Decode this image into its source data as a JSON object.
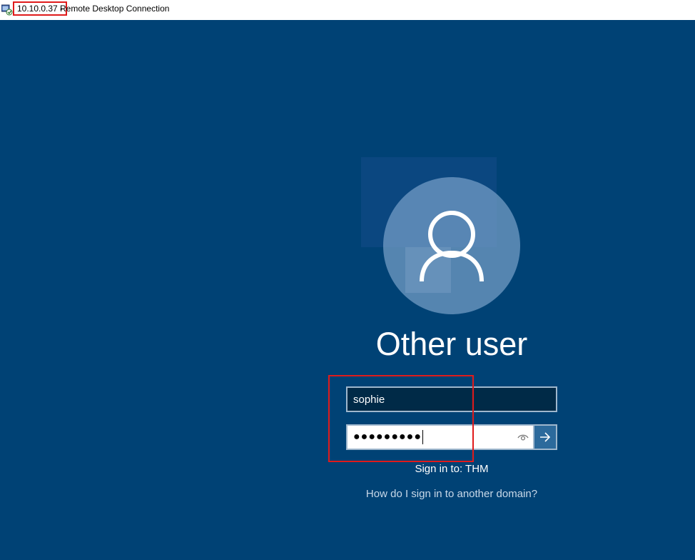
{
  "titlebar": {
    "ip": "10.10.0.37 -",
    "app_name": "Remote Desktop Connection",
    "icon": "remote-desktop-icon"
  },
  "login": {
    "user_display": "Other user",
    "avatar_icon": "user-silhouette-icon",
    "username_value": "sophie",
    "password_mask": "●●●●●●●●●",
    "reveal_icon": "eye-icon",
    "submit_icon": "arrow-right-icon",
    "sign_in_to": "Sign in to: THM",
    "other_domain_link": "How do I sign in to another domain?"
  },
  "colors": {
    "background": "#004275",
    "annotation": "#e01b1b",
    "input_dark": "#002a47",
    "submit": "#2c6a9c"
  }
}
